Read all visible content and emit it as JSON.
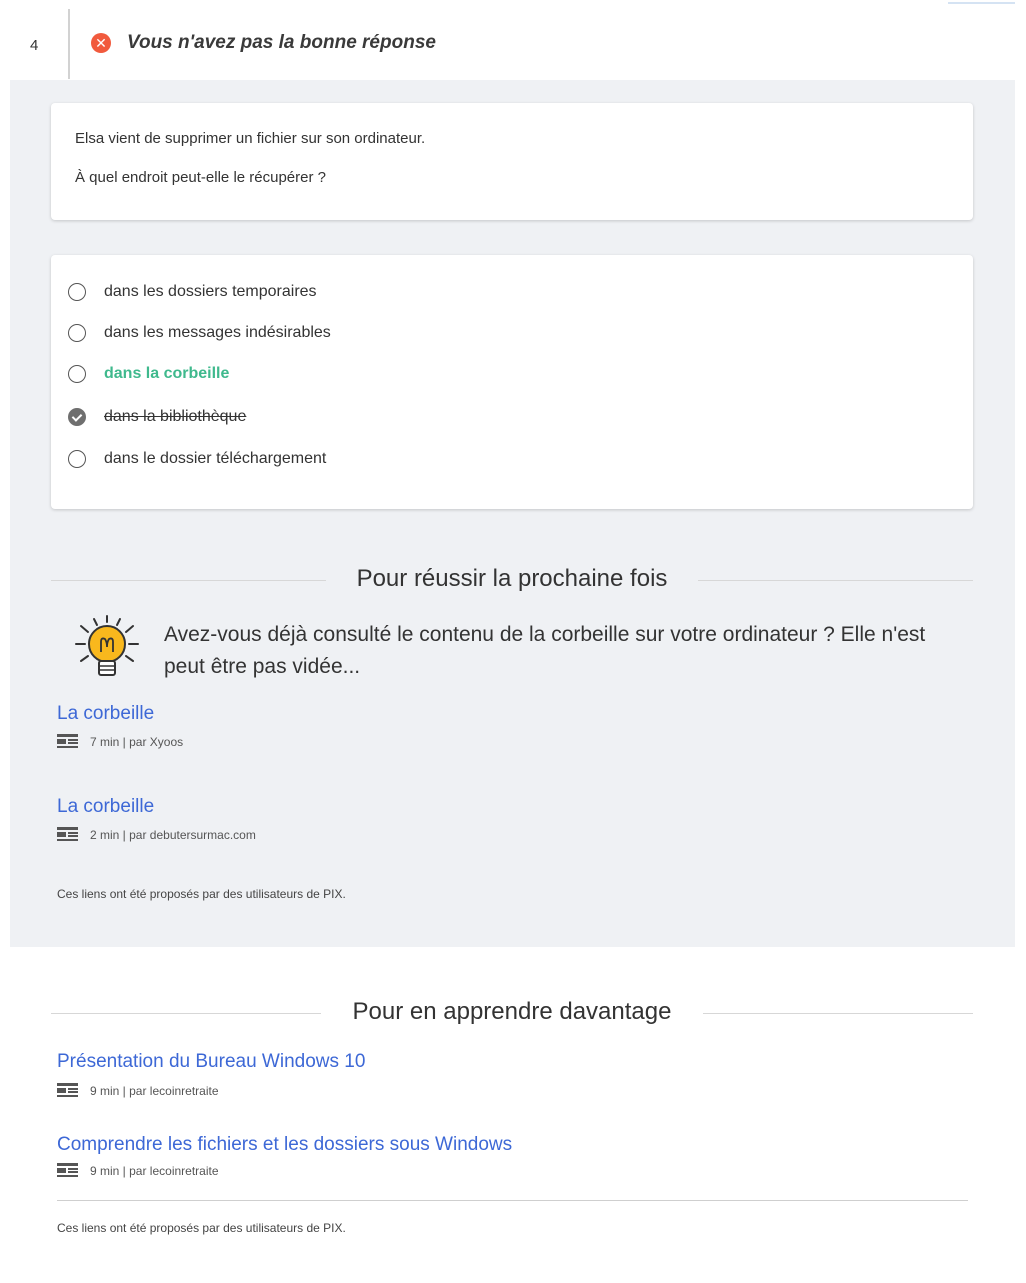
{
  "header": {
    "question_number": "4",
    "result_text": "Vous n'avez pas la bonne réponse",
    "result_icon": "error-x-icon"
  },
  "question": {
    "line1": "Elsa vient de supprimer un fichier sur son ordinateur.",
    "line2": "À quel endroit peut-elle le récupérer ?"
  },
  "answers": [
    {
      "label": "dans les dossiers temporaires",
      "state": "unselected"
    },
    {
      "label": "dans les messages indésirables",
      "state": "unselected"
    },
    {
      "label": "dans la corbeille",
      "state": "correct"
    },
    {
      "label": "dans la bibliothèque",
      "state": "selected-wrong"
    },
    {
      "label": "dans le dossier téléchargement",
      "state": "unselected"
    }
  ],
  "tutorial_section": {
    "title": "Pour réussir la prochaine fois",
    "hint": "Avez-vous déjà consulté le contenu de la corbeille sur votre ordinateur ? Elle n'est peut être pas vidée...",
    "links": [
      {
        "title": "La corbeille",
        "meta": "7 min  |  par Xyoos"
      },
      {
        "title": "La corbeille",
        "meta": "2 min  |  par debutersurmac.com"
      }
    ],
    "credit": "Ces liens ont été proposés par des utilisateurs de PIX."
  },
  "learn_more_section": {
    "title": "Pour en apprendre davantage",
    "links": [
      {
        "title": "Présentation du Bureau Windows 10",
        "meta": "9 min  |  par lecoinretraite"
      },
      {
        "title": "Comprendre les fichiers et les dossiers sous Windows",
        "meta": "9 min  |  par lecoinretraite"
      }
    ],
    "credit": "Ces liens ont été proposés par des utilisateurs de PIX."
  },
  "colors": {
    "correct": "#3fb98d",
    "error": "#f15a3d",
    "link": "#3d68d6",
    "grey_bg": "#eff1f4"
  }
}
